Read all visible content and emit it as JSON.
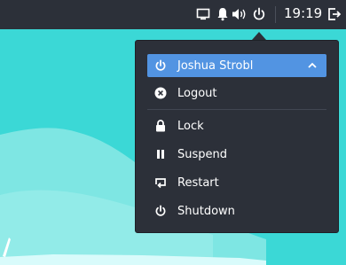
{
  "colors": {
    "desktop_bg": "#3bd8d6",
    "panel_bg": "#2c3039",
    "accent": "#5294e2",
    "text": "#ffffff"
  },
  "top_panel": {
    "tray_icons": [
      "display-icon",
      "bell-icon",
      "volume-icon",
      "power-icon"
    ],
    "clock": "19:19",
    "end_icon": "logout-icon"
  },
  "power_menu": {
    "user": {
      "label": "Joshua Strobl",
      "icon": "power-icon",
      "expanded_icon": "chevron-up-icon"
    },
    "logout": {
      "label": "Logout",
      "icon": "close-circle-icon"
    },
    "items": [
      {
        "label": "Lock",
        "icon": "lock-icon"
      },
      {
        "label": "Suspend",
        "icon": "pause-icon"
      },
      {
        "label": "Restart",
        "icon": "restart-icon"
      },
      {
        "label": "Shutdown",
        "icon": "power-icon"
      }
    ]
  }
}
